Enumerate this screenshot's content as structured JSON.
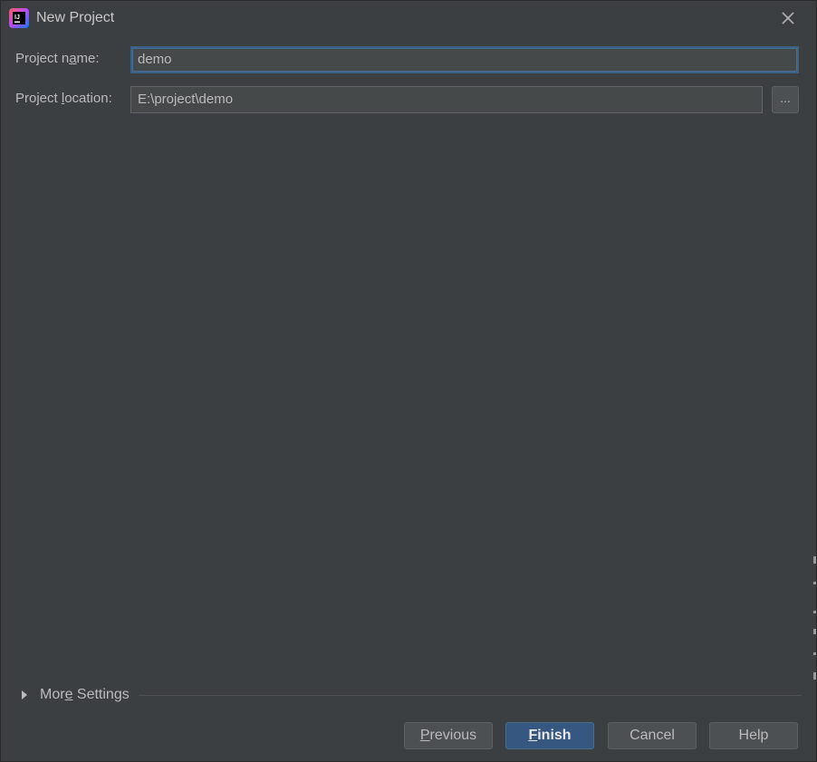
{
  "window": {
    "title": "New Project",
    "icon": "intellij-idea-icon",
    "close_icon": "close-icon"
  },
  "form": {
    "project_name": {
      "label_prefix": "Project n",
      "label_mnemonic": "a",
      "label_suffix": "me:",
      "value": "demo"
    },
    "project_location": {
      "label_prefix": "Project ",
      "label_mnemonic": "l",
      "label_suffix": "ocation:",
      "value": "E:\\project\\demo",
      "browse_label": "..."
    }
  },
  "more_settings": {
    "label_prefix": "Mor",
    "label_mnemonic": "e",
    "label_suffix": " Settings",
    "expanded": false
  },
  "buttons": {
    "previous": {
      "mnemonic": "P",
      "rest": "revious"
    },
    "finish": {
      "mnemonic": "F",
      "rest": "inish"
    },
    "cancel": {
      "label": "Cancel"
    },
    "help": {
      "label": "Help"
    }
  },
  "colors": {
    "background": "#3c3f41",
    "field_background": "#45494a",
    "focus_border": "#3d6185",
    "primary_button": "#365880",
    "text": "#bbbbbb"
  }
}
